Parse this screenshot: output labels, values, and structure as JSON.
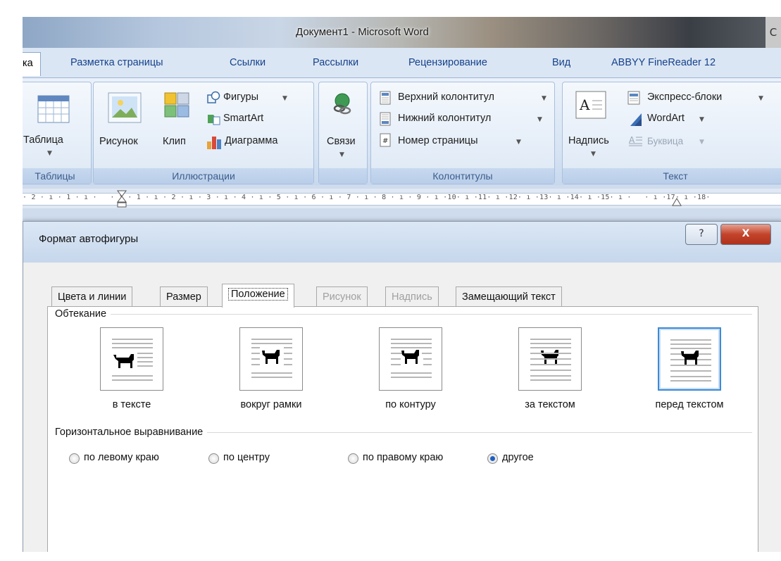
{
  "window": {
    "title": "Документ1 - Microsoft Word",
    "control_glyph": "С"
  },
  "ribbon_tabs": [
    {
      "label": "ка",
      "active": true
    },
    {
      "label": "Разметка страницы"
    },
    {
      "label": "Ссылки"
    },
    {
      "label": "Рассылки"
    },
    {
      "label": "Рецензирование"
    },
    {
      "label": "Вид"
    },
    {
      "label": "ABBYY FineReader 12"
    }
  ],
  "ribbon": {
    "groups": {
      "tables": {
        "label": "Таблицы",
        "table_button": "Таблица"
      },
      "illustrations": {
        "label": "Иллюстрации",
        "picture": "Рисунок",
        "clip": "Клип",
        "shapes": "Фигуры",
        "smartart": "SmartArt",
        "chart": "Диаграмма"
      },
      "links": {
        "label": "Связи"
      },
      "header_footer": {
        "label": "Колонтитулы",
        "header": "Верхний колонтитул",
        "footer": "Нижний колонтитул",
        "page_number": "Номер страницы"
      },
      "text": {
        "label": "Текст",
        "textbox": "Надпись",
        "quickparts": "Экспресс-блоки",
        "wordart": "WordArt",
        "dropcap": "Буквица"
      }
    }
  },
  "ruler": {
    "ticks": "· 2 · ı · 1 · ı ·   · ı · 1 · ı · 2 · ı · 3 · ı · 4 · ı · 5 · ı · 6 · ı · 7 · ı · 8 · ı · 9 · ı ·10· ı ·11· ı ·12· ı ·13· ı ·14· ı ·15· ı ·   · ı ·17· ı ·18·"
  },
  "dialog": {
    "title": "Формат автофигуры",
    "help_label": "?",
    "close_label": "X",
    "tabs": [
      {
        "label": "Цвета и линии",
        "state": "normal"
      },
      {
        "label": "Размер",
        "state": "normal"
      },
      {
        "label": "Положение",
        "state": "selected"
      },
      {
        "label": "Рисунок",
        "state": "disabled"
      },
      {
        "label": "Надпись",
        "state": "disabled"
      },
      {
        "label": "Замещающий текст",
        "state": "normal"
      }
    ],
    "wrapping": {
      "section_label": "Обтекание",
      "options": [
        {
          "label": "в тексте",
          "selected": false
        },
        {
          "label": "вокруг рамки",
          "selected": false
        },
        {
          "label": "по контуру",
          "selected": false
        },
        {
          "label": "за текстом",
          "selected": false
        },
        {
          "label": "перед текстом",
          "selected": true
        }
      ]
    },
    "horizontal_alignment": {
      "section_label": "Горизонтальное выравнивание",
      "options": [
        {
          "label": "по левому краю",
          "checked": false
        },
        {
          "label": "по центру",
          "checked": false
        },
        {
          "label": "по правому краю",
          "checked": false
        },
        {
          "label": "другое",
          "checked": true
        }
      ]
    }
  },
  "colors": {
    "accent": "#15428b",
    "selection_border": "#3c8bd6",
    "close_button": "#c3432a"
  }
}
